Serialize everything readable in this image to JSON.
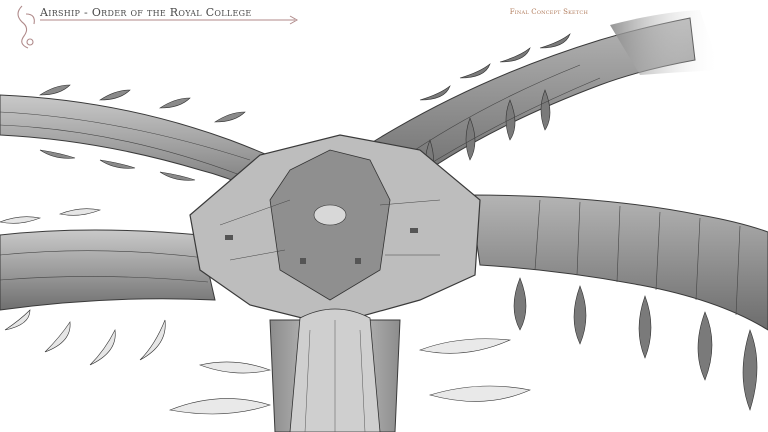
{
  "header": {
    "title": "Airship - Order of the Royal College",
    "subtitle": "Final Concept Sketch"
  },
  "colors": {
    "background": "#ffffff",
    "ink": "#3a3a3a",
    "hull": "#9a9a9a",
    "accent": "#b07a5a"
  },
  "icons": [
    "flourish-ornament-icon",
    "arrow-rule-icon"
  ]
}
